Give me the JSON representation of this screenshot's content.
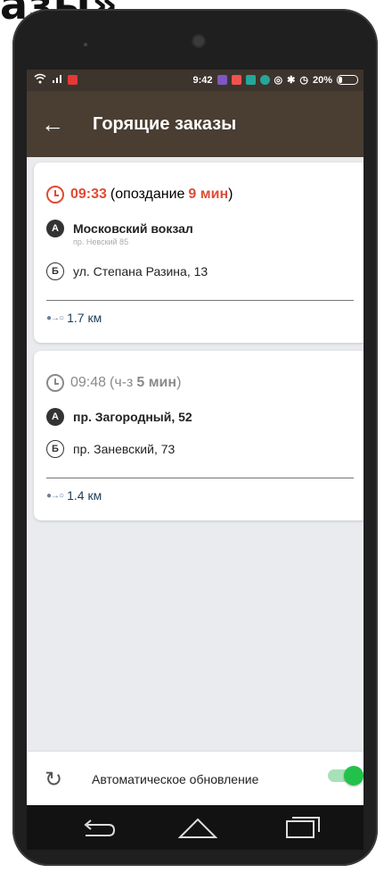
{
  "banner_text": "азы»",
  "status_bar": {
    "time": "9:42",
    "battery": "20%"
  },
  "toolbar": {
    "title": "Горящие заказы"
  },
  "orders": [
    {
      "time": "09:33",
      "status_prefix": "(опоздание ",
      "status_value": "9 мин",
      "status_suffix": ")",
      "from_badge": "А",
      "from": "Московский вокзал",
      "from_sub": "пр. Невский 85",
      "to_badge": "Б",
      "to": "ул. Степана Разина, 13",
      "distance": "1.7 км"
    },
    {
      "time": "09:48",
      "status_prefix": "(ч-з ",
      "status_value": "5 мин",
      "status_suffix": ")",
      "from_badge": "А",
      "from": "пр. Загородный, 52",
      "to_badge": "Б",
      "to": "пр. Заневский, 73",
      "distance": "1.4 км"
    }
  ],
  "footer": {
    "auto_update_label": "Автоматическое обновление",
    "auto_update_on": true
  },
  "colors": {
    "toolbar": "#4a3d32",
    "statusbar": "#3d342d",
    "late": "#e04b35",
    "toggle_on": "#22c24a",
    "background": "#e9ebee"
  },
  "icons": [
    "back-arrow-icon",
    "clock-icon",
    "refresh-icon",
    "distance-icon",
    "nav-back-icon",
    "nav-home-icon",
    "nav-recent-icon"
  ]
}
